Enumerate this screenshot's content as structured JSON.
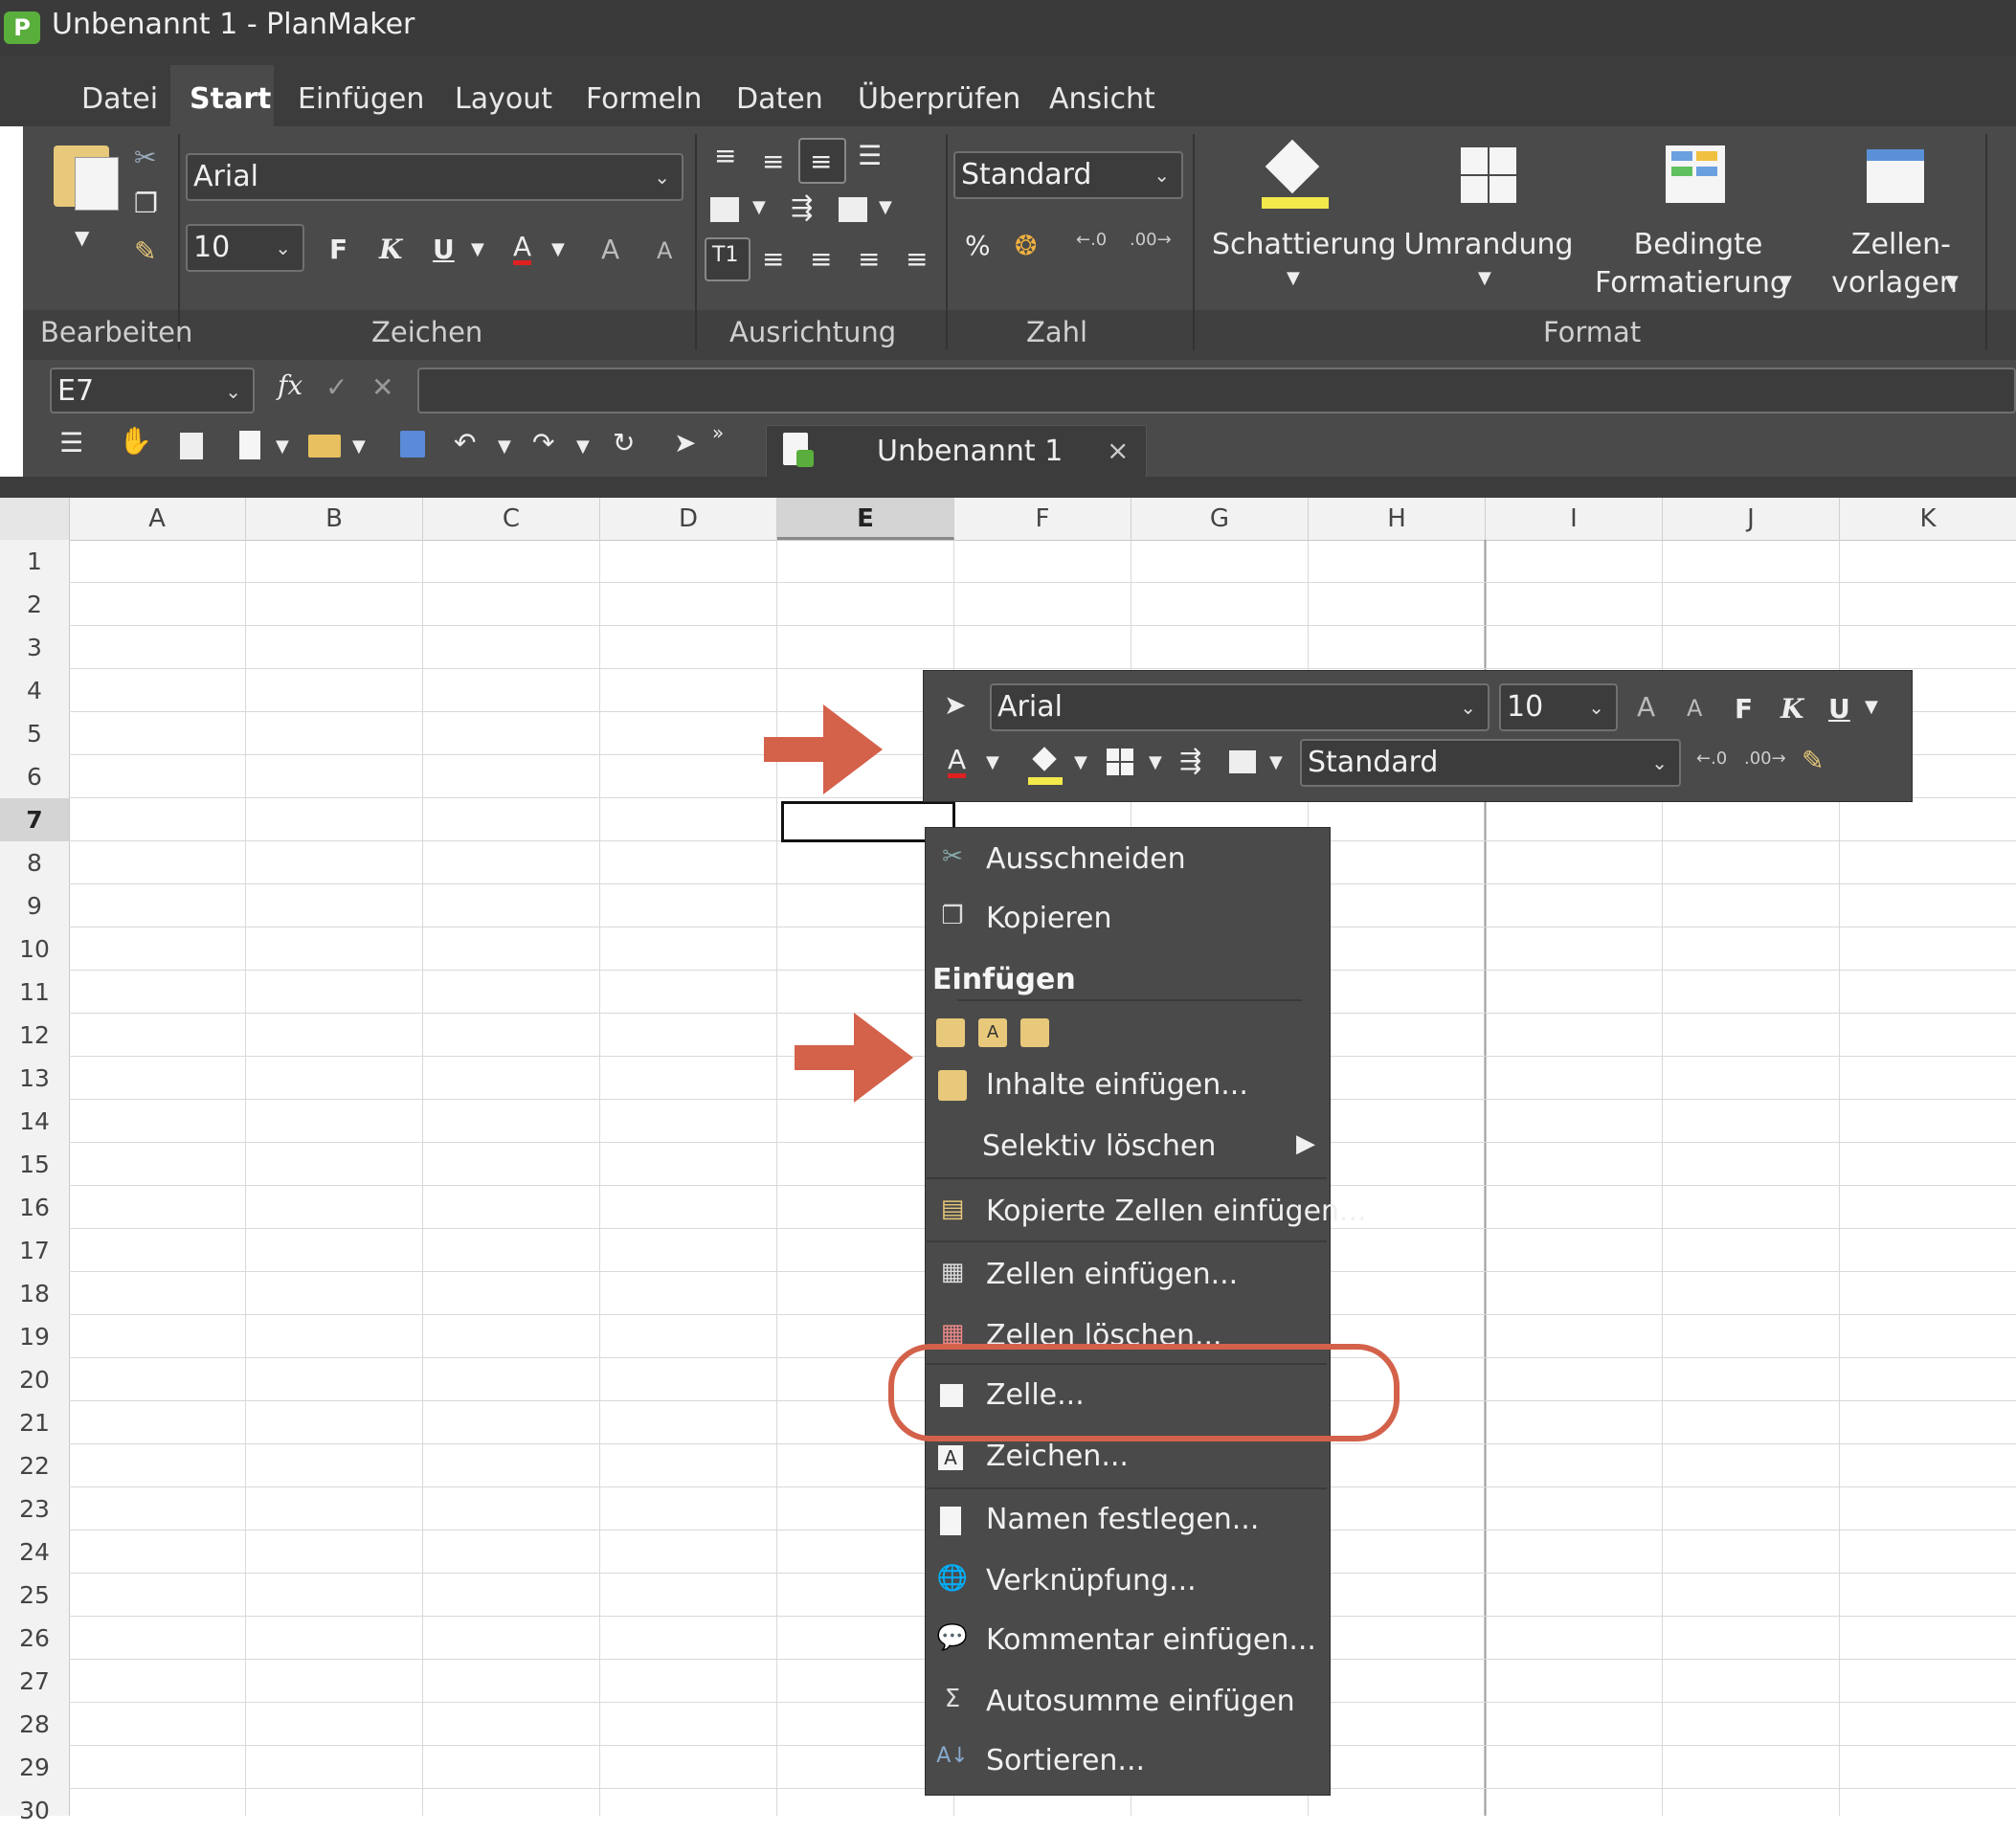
{
  "window": {
    "title": "Unbenannt 1 - PlanMaker",
    "logo_letter": "P"
  },
  "menu": {
    "tabs": [
      "Datei",
      "Start",
      "Einfügen",
      "Layout",
      "Formeln",
      "Daten",
      "Überprüfen",
      "Ansicht"
    ],
    "active": "Start"
  },
  "ribbon": {
    "groups": [
      "Bearbeiten",
      "Zeichen",
      "Ausrichtung",
      "Zahl",
      "Format"
    ],
    "font_name": "Arial",
    "font_size": "10",
    "bold_label": "F",
    "italic_label": "K",
    "underline_label": "U",
    "font_color_label": "A",
    "grow_label": "A",
    "shrink_label": "A",
    "number_format": "Standard",
    "percent_label": "%",
    "big_buttons": {
      "shading": "Schattierung",
      "border": "Umrandung",
      "conditional_1": "Bedingte",
      "conditional_2": "Formatierung",
      "styles_1": "Zellen-",
      "styles_2": "vorlagen"
    }
  },
  "formula_bar": {
    "cell_ref": "E7",
    "fx_label": "fx",
    "value": ""
  },
  "document_tab": {
    "label": "Unbenannt 1",
    "close": "×"
  },
  "grid": {
    "columns": [
      "A",
      "B",
      "C",
      "D",
      "E",
      "F",
      "G",
      "H",
      "I",
      "J",
      "K"
    ],
    "rows": [
      "1",
      "2",
      "3",
      "4",
      "5",
      "6",
      "7",
      "8",
      "9",
      "10",
      "11",
      "12",
      "13",
      "14",
      "15",
      "16",
      "17",
      "18",
      "19",
      "20",
      "21",
      "22",
      "23",
      "24",
      "25",
      "26",
      "27",
      "28",
      "29",
      "30"
    ],
    "selected_column": "E",
    "selected_row": "7"
  },
  "mini_toolbar": {
    "font_name": "Arial",
    "font_size": "10",
    "bold_label": "F",
    "italic_label": "K",
    "underline_label": "U",
    "font_color_label": "A",
    "grow_label": "A",
    "shrink_label": "A",
    "number_format": "Standard"
  },
  "context_menu": {
    "cut": "Ausschneiden",
    "copy": "Kopieren",
    "paste_section": "Einfügen",
    "paste_special": "Inhalte einfügen...",
    "selective_delete": "Selektiv löschen",
    "insert_copied": "Kopierte Zellen einfügen...",
    "insert_cells": "Zellen einfügen...",
    "delete_cells": "Zellen löschen...",
    "cell": "Zelle...",
    "character": "Zeichen...",
    "define_names": "Namen festlegen...",
    "link": "Verknüpfung...",
    "comment": "Kommentar einfügen...",
    "autosum": "Autosumme einfügen",
    "sort": "Sortieren..."
  },
  "colors": {
    "accent_arrow": "#d4614a",
    "chrome": "#4a4a4a",
    "title": "#3a3a3a"
  }
}
